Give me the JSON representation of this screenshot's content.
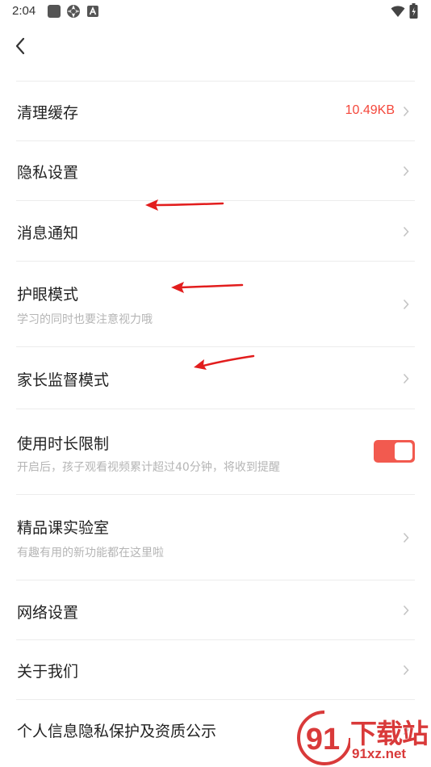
{
  "status_bar": {
    "time": "2:04",
    "icons": [
      "square-icon",
      "aperture-icon",
      "a-badge-icon",
      "wifi-icon",
      "battery-icon"
    ]
  },
  "nav": {
    "back_icon": "chevron-left-icon"
  },
  "settings": {
    "items": [
      {
        "title": "清理缓存",
        "value": "10.49KB"
      },
      {
        "title": "隐私设置"
      },
      {
        "title": "消息通知"
      },
      {
        "title": "护眼模式",
        "subtitle": "学习的同时也要注意视力哦"
      },
      {
        "title": "家长监督模式"
      },
      {
        "title": "使用时长限制",
        "subtitle": "开启后，孩子观看视频累计超过40分钟，将收到提醒",
        "toggle_on": true
      },
      {
        "title": "精品课实验室",
        "subtitle": "有趣有用的新功能都在这里啦"
      },
      {
        "title": "网络设置"
      },
      {
        "title": "关于我们"
      },
      {
        "title": "个人信息隐私保护及资质公示"
      }
    ]
  },
  "watermark": {
    "logo_digits": "91",
    "title": "下载站",
    "url": "91xz.net"
  },
  "colors": {
    "accent": "#f25a4f",
    "value_text": "#f4473b",
    "annotation_arrow": "#e21d1d",
    "divider": "#ececec"
  }
}
